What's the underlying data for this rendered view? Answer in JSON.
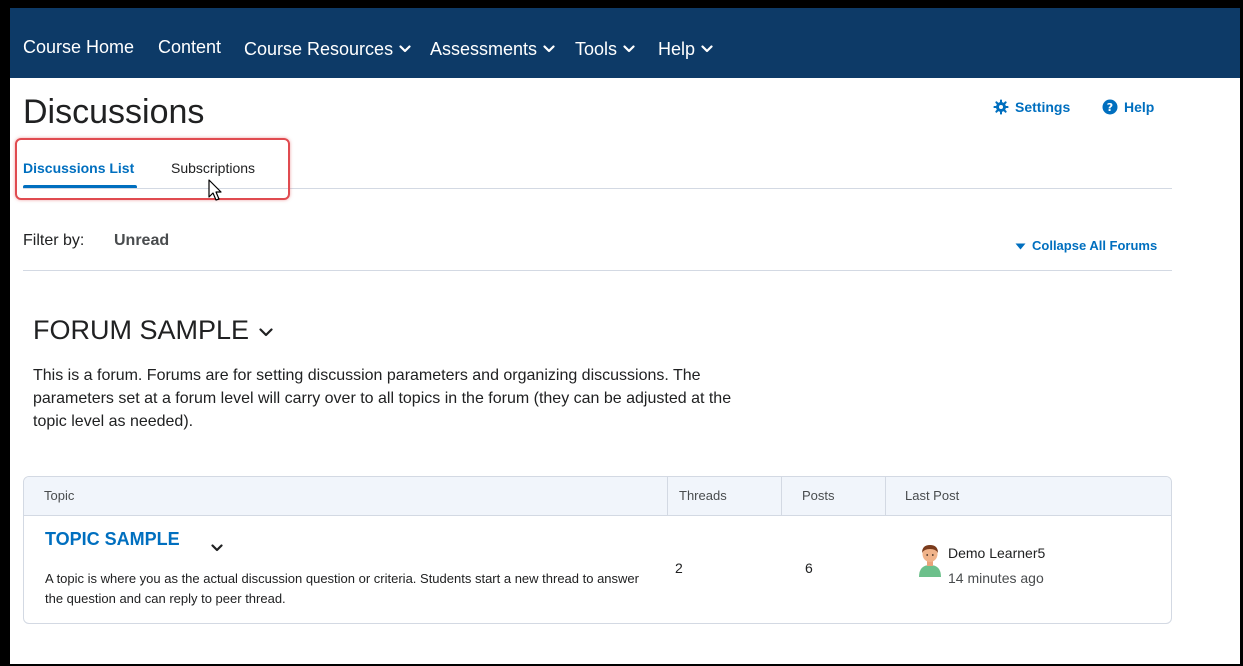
{
  "navbar": {
    "items": [
      {
        "label": "Course Home",
        "has_dropdown": false
      },
      {
        "label": "Content",
        "has_dropdown": false
      },
      {
        "label": "Course Resources",
        "has_dropdown": true
      },
      {
        "label": "Assessments",
        "has_dropdown": true
      },
      {
        "label": "Tools",
        "has_dropdown": true
      },
      {
        "label": "Help",
        "has_dropdown": true
      }
    ]
  },
  "header": {
    "title": "Discussions",
    "settings_label": "Settings",
    "help_label": "Help"
  },
  "tabs": [
    {
      "label": "Discussions List",
      "active": true
    },
    {
      "label": "Subscriptions",
      "active": false
    }
  ],
  "filter": {
    "label": "Filter by:",
    "value": "Unread",
    "collapse_all_label": "Collapse All Forums"
  },
  "forum": {
    "title": "FORUM SAMPLE",
    "description": "This is a forum. Forums are for setting discussion parameters and organizing discussions. The parameters set at a forum level will carry over to all topics in the forum (they can be adjusted at the topic level as needed)."
  },
  "table": {
    "headers": {
      "topic": "Topic",
      "threads": "Threads",
      "posts": "Posts",
      "last_post": "Last Post"
    },
    "rows": [
      {
        "topic": "TOPIC SAMPLE",
        "description": "A topic is where you as the actual discussion question or criteria. Students start a new thread to answer the question and can reply to peer thread.",
        "threads": "2",
        "posts": "6",
        "last_post_user": "Demo Learner5",
        "last_post_time": "14 minutes ago"
      }
    ]
  },
  "colors": {
    "navbar_bg": "#0d3a67",
    "link": "#006fbf",
    "highlight": "#e04b50"
  },
  "icons": [
    "chevron-down-icon",
    "gear-icon",
    "help-circle-icon",
    "caret-down-icon",
    "avatar-icon",
    "mouse-cursor-icon"
  ]
}
